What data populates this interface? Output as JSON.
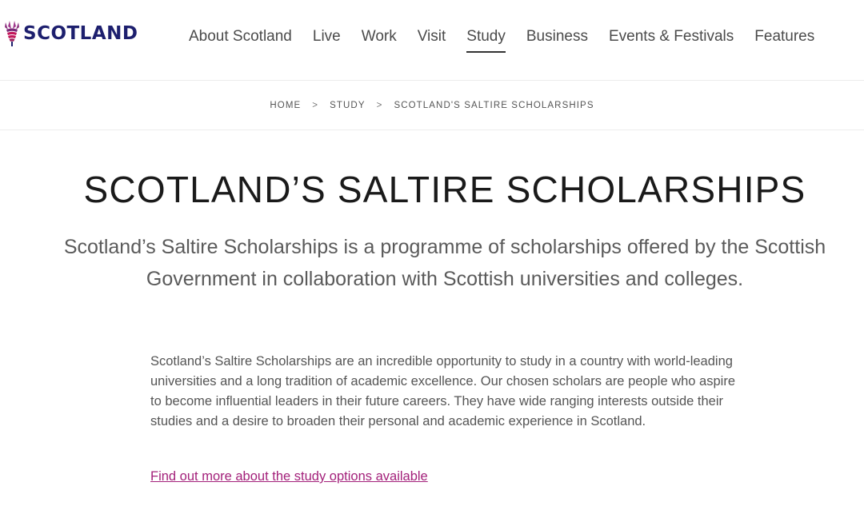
{
  "header": {
    "logo_text": "SCOTLAND",
    "nav": [
      {
        "label": "About Scotland",
        "active": false
      },
      {
        "label": "Live",
        "active": false
      },
      {
        "label": "Work",
        "active": false
      },
      {
        "label": "Visit",
        "active": false
      },
      {
        "label": "Study",
        "active": true
      },
      {
        "label": "Business",
        "active": false
      },
      {
        "label": "Events & Festivals",
        "active": false
      },
      {
        "label": "Features",
        "active": false
      }
    ]
  },
  "breadcrumb": {
    "items": [
      "HOME",
      "STUDY",
      "SCOTLAND'S SALTIRE SCHOLARSHIPS"
    ],
    "separator": ">"
  },
  "main": {
    "title": "SCOTLAND’S SALTIRE SCHOLARSHIPS",
    "lead": "Scotland’s Saltire Scholarships is a programme of scholarships offered by the Scottish Government in collaboration with Scottish universities and colleges.",
    "body": "Scotland’s Saltire Scholarships are an incredible opportunity to study in a country with world-leading universities and a long tradition of academic excellence. Our chosen scholars are people who aspire to become influential leaders in their future careers. They have wide ranging interests outside their studies and a desire to broaden their personal and academic experience in Scotland.",
    "link_text": "Find out more about the study options available"
  },
  "colors": {
    "brand_navy": "#1d1f6e",
    "thistle_purple": "#8b2f7e",
    "thistle_pink": "#c2185b",
    "link": "#a3207a"
  },
  "icons": {
    "logo": "thistle-icon"
  }
}
